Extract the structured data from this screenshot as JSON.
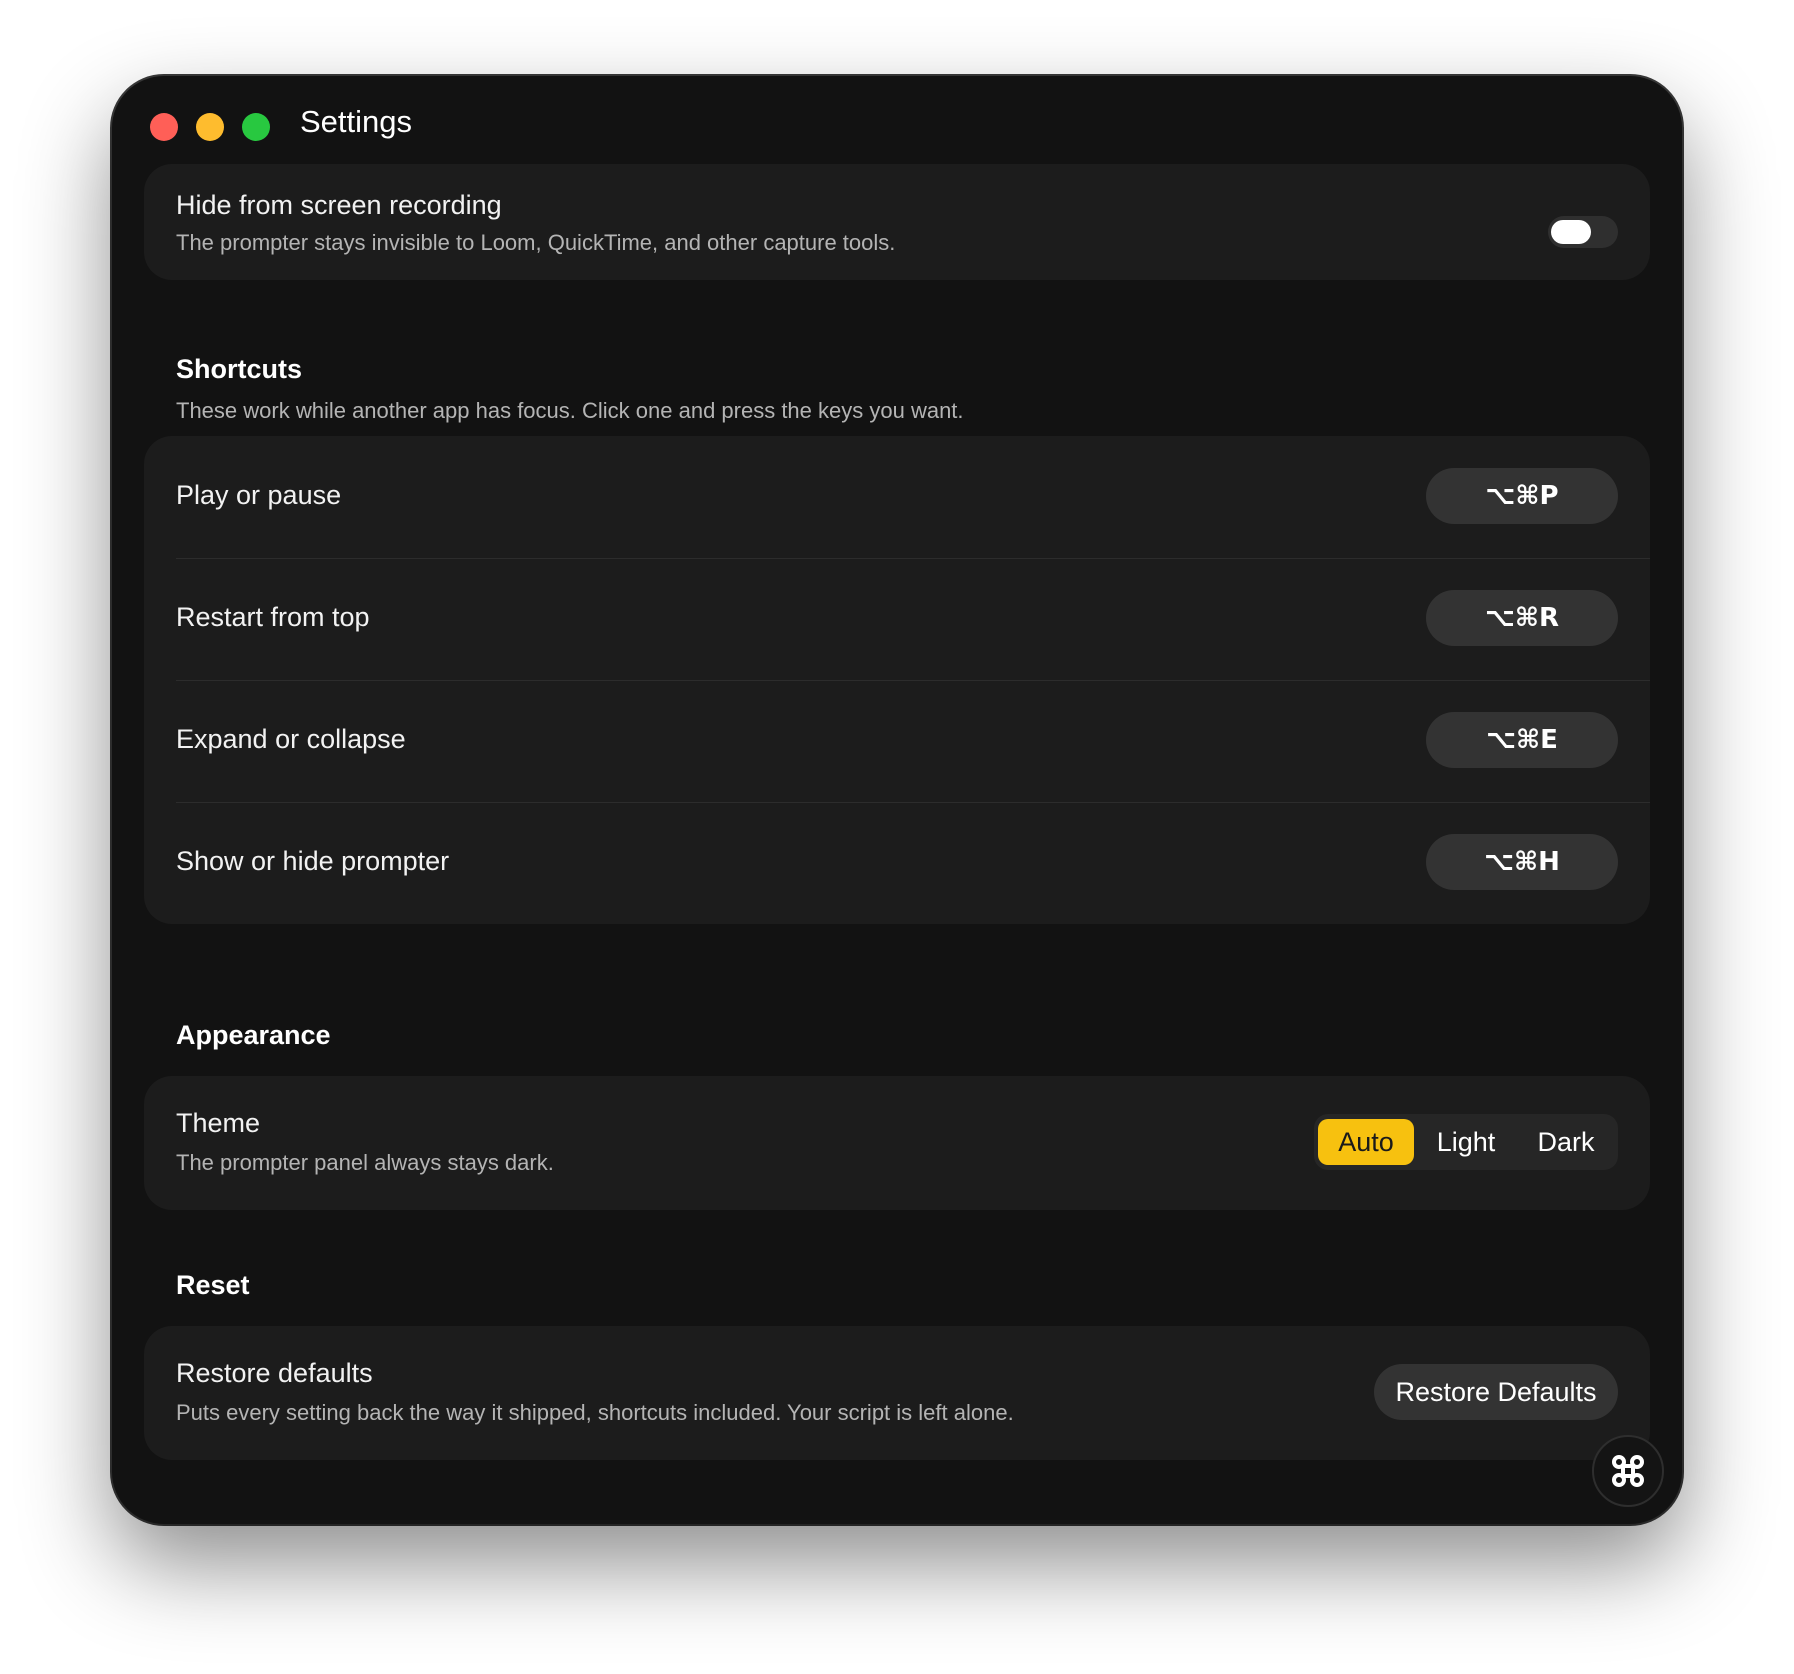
{
  "window": {
    "title": "Settings"
  },
  "recording": {
    "title": "Hide from screen recording",
    "description": "The prompter stays invisible to Loom, QuickTime, and other capture tools.",
    "enabled": false
  },
  "shortcuts": {
    "title": "Shortcuts",
    "description": "These work while another app has focus. Click one and press the keys you want.",
    "items": [
      {
        "label": "Play or pause",
        "keys": "⌥⌘P"
      },
      {
        "label": "Restart from top",
        "keys": "⌥⌘R"
      },
      {
        "label": "Expand or collapse",
        "keys": "⌥⌘E"
      },
      {
        "label": "Show or hide prompter",
        "keys": "⌥⌘H"
      }
    ]
  },
  "appearance": {
    "title": "Appearance",
    "theme": {
      "title": "Theme",
      "description": "The prompter panel always stays dark.",
      "options": [
        "Auto",
        "Light",
        "Dark"
      ],
      "selected": "Auto",
      "accent_color": "#f7c10f"
    }
  },
  "reset": {
    "title": "Reset",
    "restore": {
      "title": "Restore defaults",
      "description": "Puts every setting back the way it shipped, shortcuts included. Your script is left alone.",
      "button_label": "Restore Defaults"
    }
  },
  "icons": {
    "corner_button": "command-icon"
  }
}
